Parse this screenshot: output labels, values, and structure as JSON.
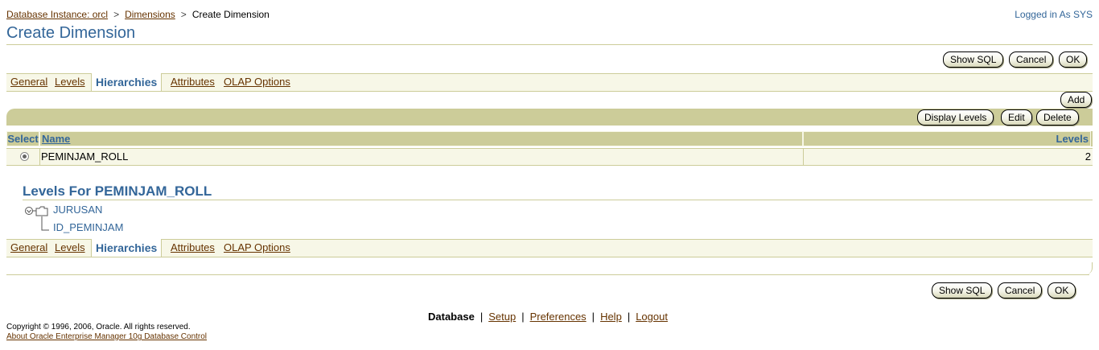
{
  "breadcrumb": {
    "items": [
      "Database Instance: orcl",
      "Dimensions"
    ],
    "current": "Create Dimension",
    "separator": ">"
  },
  "header": {
    "logged_in": "Logged in As SYS",
    "title": "Create Dimension"
  },
  "buttons": {
    "show_sql": "Show SQL",
    "cancel": "Cancel",
    "ok": "OK",
    "add": "Add",
    "display_levels": "Display Levels",
    "edit": "Edit",
    "delete": "Delete"
  },
  "tabs": [
    {
      "label": "General",
      "active": false
    },
    {
      "label": "Levels",
      "active": false
    },
    {
      "label": "Hierarchies",
      "active": true
    },
    {
      "label": "Attributes",
      "active": false
    },
    {
      "label": "OLAP Options",
      "active": false
    }
  ],
  "table": {
    "columns": [
      "Select",
      "Name",
      "Levels"
    ],
    "rows": [
      {
        "selected": true,
        "name": "PEMINJAM_ROLL",
        "levels": "2"
      }
    ]
  },
  "levels_section": {
    "title": "Levels For PEMINJAM_ROLL",
    "tree": [
      "JURUSAN",
      "ID_PEMINJAM"
    ]
  },
  "footer": {
    "links": [
      "Database",
      "Setup",
      "Preferences",
      "Help",
      "Logout"
    ],
    "separator": "|",
    "copyright": "Copyright © 1996, 2006, Oracle. All rights reserved.",
    "about": "About Oracle Enterprise Manager 10g Database Control"
  },
  "colors": {
    "title_blue": "#336699",
    "link_brown": "#663300",
    "tan": "#cccc99",
    "light_tan": "#f7f7e7"
  },
  "icons": [
    "radio-selected-icon",
    "tree-collapse-icon",
    "folder-icon",
    "tree-branch-icon"
  ]
}
